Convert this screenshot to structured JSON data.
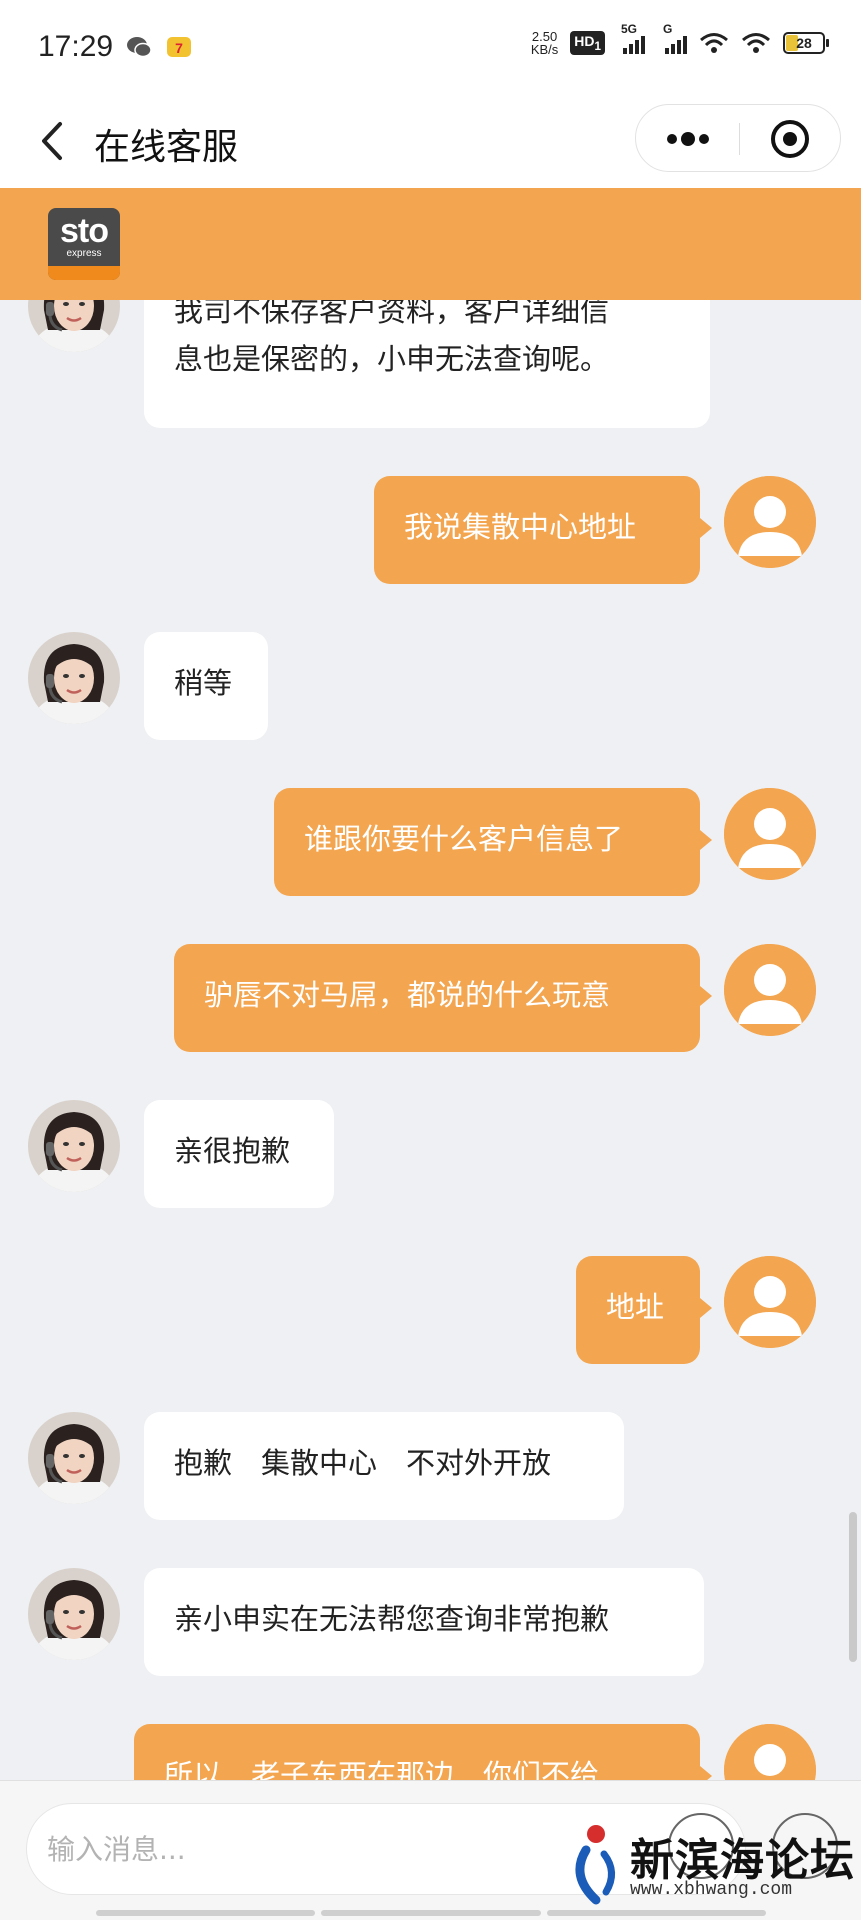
{
  "status_bar": {
    "time": "17:29",
    "net_speed_value": "2.50",
    "net_speed_unit": "KB/s",
    "hd_label": "HD",
    "hd_sub": "1",
    "signal1_label": "5G",
    "signal2_label": "G",
    "battery": "28"
  },
  "nav": {
    "title": "在线客服"
  },
  "brand": {
    "logo_text": "sto",
    "logo_sub": "express",
    "color": "#f3a54f"
  },
  "messages": [
    {
      "sender": "agent",
      "lines": [
        "我司不保存客户资料，客户详细信",
        "息也是保密的，小申无法查询呢。"
      ]
    },
    {
      "sender": "user",
      "lines": [
        "我说集散中心地址"
      ]
    },
    {
      "sender": "agent",
      "lines": [
        "稍等"
      ]
    },
    {
      "sender": "user",
      "lines": [
        "谁跟你要什么客户信息了"
      ]
    },
    {
      "sender": "user",
      "lines": [
        "驴唇不对马屌，都说的什么玩意"
      ]
    },
    {
      "sender": "agent",
      "lines": [
        "亲很抱歉"
      ]
    },
    {
      "sender": "user",
      "lines": [
        "地址"
      ]
    },
    {
      "sender": "agent",
      "lines": [
        "抱歉　集散中心　不对外开放"
      ]
    },
    {
      "sender": "agent",
      "lines": [
        "亲小申实在无法帮您查询非常抱歉"
      ]
    },
    {
      "sender": "user",
      "lines": [
        "所以　老子东西在那边　你们不给"
      ]
    }
  ],
  "input": {
    "placeholder": "输入消息..."
  },
  "watermark": {
    "text": "新滨海论坛",
    "url": "www.xbhwang.com"
  }
}
